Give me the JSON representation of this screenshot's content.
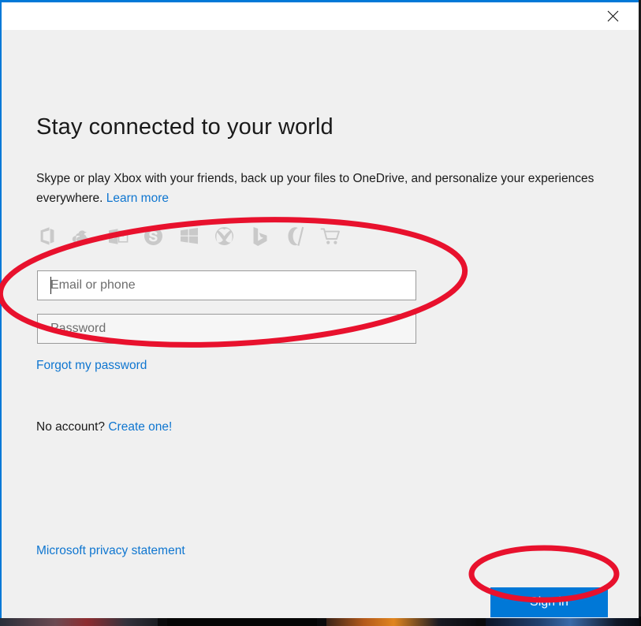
{
  "window": {
    "close_icon": "close-icon",
    "border_color": "#0078d7",
    "titlebar_bg": "#ffffff",
    "body_bg": "#f0f0f0"
  },
  "headline": "Stay connected to your world",
  "subtext": {
    "part1": "Skype or play Xbox with your friends, back up your files to OneDrive, and personalize your experiences everywhere. ",
    "learn_more": "Learn more"
  },
  "brand_icons": [
    {
      "name": "office-icon",
      "label": "Office"
    },
    {
      "name": "onedrive-cloud-icon",
      "label": "OneDrive"
    },
    {
      "name": "outlook-icon",
      "label": "Outlook"
    },
    {
      "name": "skype-icon",
      "label": "Skype"
    },
    {
      "name": "windows-icon",
      "label": "Windows"
    },
    {
      "name": "xbox-icon",
      "label": "Xbox"
    },
    {
      "name": "bing-icon",
      "label": "Bing"
    },
    {
      "name": "cortana-icon",
      "label": "Cortana"
    },
    {
      "name": "store-cart-icon",
      "label": "Store"
    }
  ],
  "form": {
    "email": {
      "value": "",
      "placeholder": "Email or phone",
      "focused": true
    },
    "password": {
      "value": "",
      "placeholder": "Password",
      "focused": false
    },
    "forgot_password_label": "Forgot my password"
  },
  "no_account": {
    "prefix": "No account? ",
    "create_label": "Create one!"
  },
  "privacy_label": "Microsoft privacy statement",
  "signin_label": "Sign in",
  "colors": {
    "accent_blue": "#0078d7",
    "link_blue": "#0f76d0",
    "annotation_red": "#e8112d",
    "icon_grey": "#c9c9c9",
    "field_border": "#9a9a9a"
  },
  "annotations": [
    {
      "name": "annotation-ellipse-credentials",
      "shape": "ellipse",
      "color": "#e8112d",
      "targets": "email and password fields"
    },
    {
      "name": "annotation-ellipse-signin",
      "shape": "ellipse",
      "color": "#e8112d",
      "targets": "Sign in button"
    }
  ]
}
